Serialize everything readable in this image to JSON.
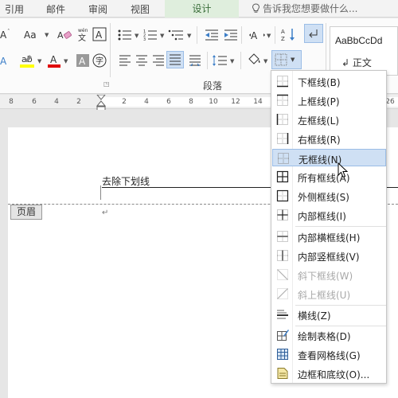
{
  "ribbon_tabs": {
    "references": "引用",
    "mailings": "邮件",
    "review": "审阅",
    "view": "视图",
    "design": "设计",
    "tell_me": "告诉我您想要做什么..."
  },
  "paragraph_group": {
    "label": "段落"
  },
  "styles": {
    "sample": "AaBbCcDd",
    "normal": "↲ 正文"
  },
  "ruler": {
    "left_numbers": [
      "8",
      "6",
      "4",
      "2"
    ],
    "right_numbers": [
      "2",
      "4",
      "6",
      "8",
      "10",
      "12",
      "14"
    ],
    "far_right": "26"
  },
  "document": {
    "header_text": "去除下划线",
    "header_tag": "页眉",
    "para_mark": "↵"
  },
  "border_menu": {
    "items": [
      {
        "label": "下框线(B)",
        "icon": "border-bottom-icon"
      },
      {
        "label": "上框线(P)",
        "icon": "border-top-icon"
      },
      {
        "label": "左框线(L)",
        "icon": "border-left-icon"
      },
      {
        "label": "右框线(R)",
        "icon": "border-right-icon"
      },
      {
        "label": "无框线(N)",
        "icon": "border-none-icon",
        "highlighted": true
      },
      {
        "label": "所有框线(A)",
        "icon": "border-all-icon"
      },
      {
        "label": "外侧框线(S)",
        "icon": "border-outside-icon"
      },
      {
        "label": "内部框线(I)",
        "icon": "border-inside-icon"
      },
      {
        "label": "内部横框线(H)",
        "icon": "border-inside-horizontal-icon"
      },
      {
        "label": "内部竖框线(V)",
        "icon": "border-inside-vertical-icon"
      },
      {
        "label": "斜下框线(W)",
        "icon": "diagonal-down-icon",
        "disabled": true
      },
      {
        "label": "斜上框线(U)",
        "icon": "diagonal-up-icon",
        "disabled": true
      },
      {
        "label": "横线(Z)",
        "icon": "horizontal-line-icon"
      },
      {
        "label": "绘制表格(D)",
        "icon": "draw-table-icon"
      },
      {
        "label": "查看网格线(G)",
        "icon": "view-gridlines-icon"
      },
      {
        "label": "边框和底纹(O)...",
        "icon": "borders-shading-icon"
      }
    ]
  },
  "colors": {
    "highlight_yellow": "#ffff00",
    "font_red": "#e00000",
    "menu_highlight": "#cfe0f4",
    "design_tab": "#dfeedd"
  }
}
